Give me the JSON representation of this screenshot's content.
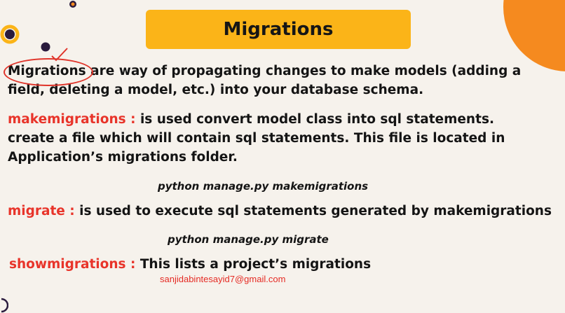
{
  "title": "Migrations",
  "intro": {
    "highlight": "Migrations",
    "text_line1": " are way of propagating changes to make models (adding a",
    "text_line2": "field, deleting a model, etc.) into your database schema."
  },
  "makemigrations": {
    "term": "makemigrations : ",
    "line1": " is used convert model class into sql statements.",
    "line2": "create a file which will contain sql statements. This file is located in",
    "line3": "Application’s migrations folder.",
    "command": "python manage.py makemigrations"
  },
  "migrate": {
    "term": "migrate : ",
    "text": "is used to execute sql statements generated by makemigrations",
    "command": "python manage.py migrate"
  },
  "showmigrations": {
    "term": "showmigrations : ",
    "text": "This lists a project’s migrations"
  },
  "email": "sanjidabintesayid7@gmail.com",
  "colors": {
    "background": "#f6f2ec",
    "title_box": "#fbb418",
    "accent_red": "#e8342a",
    "orange_shape": "#f58a1f",
    "ring_dark": "#2a1b3d"
  },
  "icons": [
    "orange-circle-decoration",
    "ring-decoration",
    "dot-decoration",
    "dot-decoration-top",
    "pen-annotation-icon"
  ]
}
